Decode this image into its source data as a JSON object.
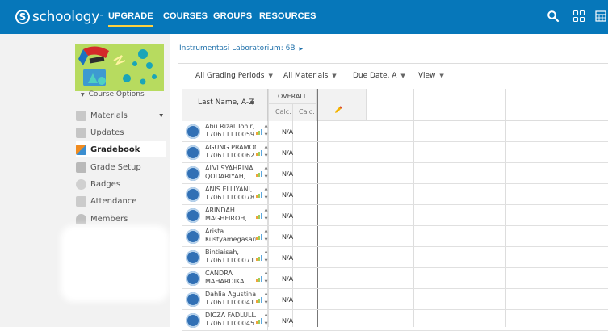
{
  "header": {
    "logo_text": "schoology",
    "logo_mark": "S",
    "nav": [
      {
        "label": "UPGRADE",
        "active": true
      },
      {
        "label": "COURSES",
        "active": false
      },
      {
        "label": "GROUPS",
        "active": false
      },
      {
        "label": "RESOURCES",
        "active": false
      }
    ],
    "icons": [
      "search-icon",
      "apps-grid-icon",
      "calendar-icon"
    ],
    "color": "#0677ba",
    "accent": "#ffd13f"
  },
  "sidebar": {
    "course_options": "Course Options",
    "items": [
      {
        "label": "Materials",
        "icon": "materials-icon",
        "active": false
      },
      {
        "label": "Updates",
        "icon": "updates-icon",
        "active": false
      },
      {
        "label": "Gradebook",
        "icon": "gradebook-icon",
        "active": true
      },
      {
        "label": "Grade Setup",
        "icon": "grade-setup-icon",
        "active": false
      },
      {
        "label": "Badges",
        "icon": "badge-icon",
        "active": false
      },
      {
        "label": "Attendance",
        "icon": "attendance-icon",
        "active": false
      },
      {
        "label": "Members",
        "icon": "members-icon",
        "active": false
      }
    ]
  },
  "main": {
    "breadcrumb": "Instrumentasi Laboratorium: 6B",
    "filters": [
      "All Grading Periods",
      "All Materials",
      "Due Date, A",
      "View"
    ],
    "sort_label": "Last Name, A-Z",
    "overall_label": "OVERALL",
    "calc_labels": [
      "Calc.",
      "Calc."
    ],
    "students": [
      {
        "name": "Abu Rizal Tohir,",
        "id": "170611110059",
        "grade": "N/A"
      },
      {
        "name": "AGUNG PRAMONO,",
        "id": "170611100062",
        "grade": "N/A"
      },
      {
        "name": "ALVI SYAHRINA",
        "id": "QODARIYAH,",
        "grade": "N/A"
      },
      {
        "name": "ANIS ELLIYANI,",
        "id": "170611100078",
        "grade": "N/A"
      },
      {
        "name": "ARINDAH",
        "id": "MAGHFIROH,",
        "grade": "N/A"
      },
      {
        "name": "Arista",
        "id": "Kustyamegasari,",
        "grade": "N/A"
      },
      {
        "name": "Bintiaisah,",
        "id": "170611100071",
        "grade": "N/A"
      },
      {
        "name": "CANDRA",
        "id": "MAHARDIKA,",
        "grade": "N/A"
      },
      {
        "name": "Dahlia Agustina RH",
        "id": "170611100041",
        "grade": "N/A"
      },
      {
        "name": "DICZA FADLULLAH",
        "id": "170611100045",
        "grade": "N/A"
      }
    ]
  }
}
